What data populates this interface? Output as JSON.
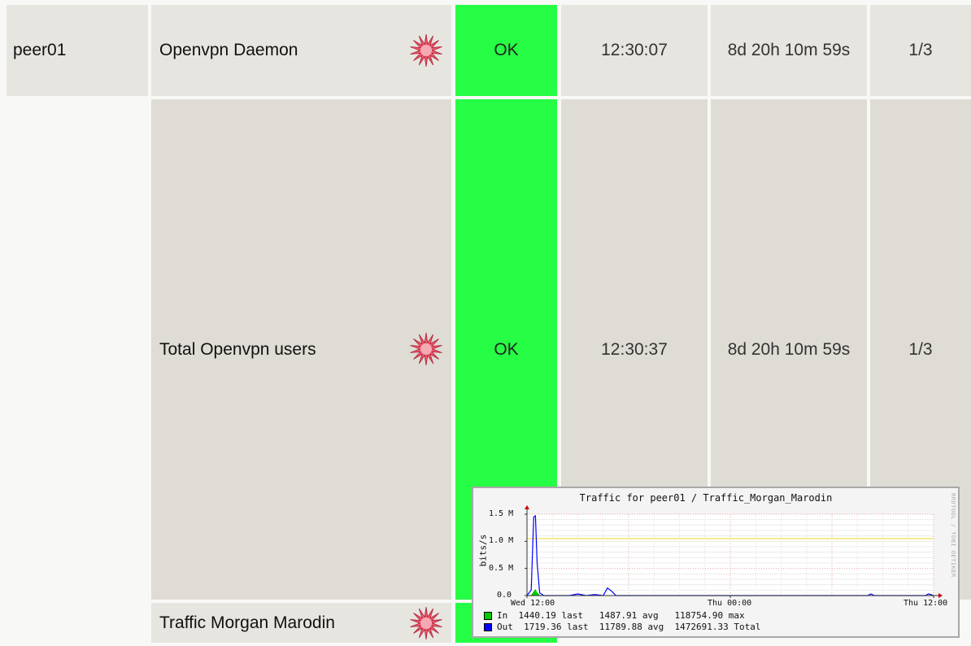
{
  "rows": [
    {
      "host": "peer01",
      "service": "Openvpn Daemon",
      "status": "OK",
      "last_check": "12:30:07",
      "duration": "8d 20h 10m 59s",
      "attempt": "1/3"
    },
    {
      "host": "",
      "service": "Total Openvpn users",
      "status": "OK",
      "last_check": "12:30:37",
      "duration": "8d 20h 10m 59s",
      "attempt": "1/3"
    },
    {
      "host": "",
      "service": "Traffic Morgan Marodin",
      "status": "",
      "last_check": "",
      "duration": "",
      "attempt": ""
    }
  ],
  "colors": {
    "ok_green": "#26fe45",
    "row_light": "#e7e5df",
    "row_dark": "#dedcd4",
    "in_series": "#00cc00",
    "out_series": "#0000ff",
    "max_line": "#f2e46a"
  },
  "graph_icon": "pnp-star-icon",
  "graph_popup": {
    "title": "Traffic for peer01 / Traffic_Morgan_Marodin",
    "side_text": "RRDTOOL / TOBI OETIKER",
    "legend": [
      {
        "name": "In",
        "text": "  1440.19 last   1487.91 avg   118754.90 max",
        "color": "#00cc00"
      },
      {
        "name": "Out",
        "text": "  1719.36 last  11789.88 avg  1472691.33 Total",
        "color": "#0000ff"
      }
    ]
  },
  "chart_data": {
    "type": "line",
    "title": "Traffic for peer01 / Traffic_Morgan_Marodin",
    "ylabel": "bits/s",
    "xlabel": "",
    "ylim": [
      0,
      1.5
    ],
    "y_unit": "M",
    "y_ticks": [
      "0.0",
      "0.5 M",
      "1.0 M",
      "1.5 M"
    ],
    "x_ticks": [
      "Wed 12:00",
      "Thu 00:00",
      "Thu 12:00"
    ],
    "grid": true,
    "reference_line": 1.05,
    "series": [
      {
        "name": "In",
        "x": [
          0,
          0.5,
          0.8,
          1.0,
          1.2,
          1.5,
          2,
          3,
          5,
          10,
          15,
          20,
          24,
          30,
          40,
          48
        ],
        "values": [
          0,
          0.01,
          0.08,
          0.12,
          0.06,
          0.01,
          0,
          0,
          0,
          0,
          0,
          0,
          0,
          0,
          0,
          0
        ]
      },
      {
        "name": "Out",
        "x": [
          0,
          0.5,
          0.8,
          1.0,
          1.2,
          1.5,
          2,
          5,
          6,
          7,
          8,
          9,
          9.5,
          10,
          10.5,
          20,
          30,
          40.2,
          40.6,
          41,
          47,
          47.4,
          48
        ],
        "values": [
          0,
          0.1,
          1.45,
          1.47,
          0.6,
          0.05,
          0,
          0,
          0.03,
          0,
          0.02,
          0,
          0.14,
          0.08,
          0,
          0,
          0,
          0,
          0.03,
          0,
          0,
          0.03,
          0
        ]
      }
    ]
  }
}
